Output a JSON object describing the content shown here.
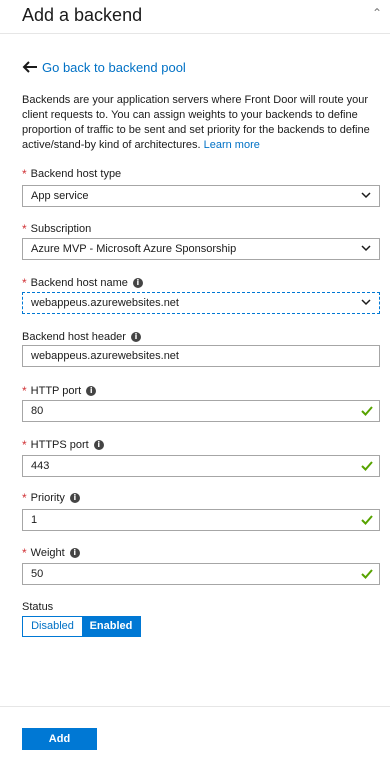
{
  "header": {
    "title": "Add a backend",
    "control_glyph": "⌃"
  },
  "back_link": {
    "label": "Go back to backend pool",
    "icon": "arrow-left-icon"
  },
  "description": {
    "text": "Backends are your application servers where Front Door will route your client requests to. You can assign weights to your backends to define proportion of traffic to be sent and set priority for the backends to define active/stand-by kind of architectures.",
    "link": "Learn more"
  },
  "fields": {
    "host_type": {
      "label": "Backend host type",
      "value": "App service"
    },
    "subscription": {
      "label": "Subscription",
      "value": "Azure MVP - Microsoft Azure Sponsorship"
    },
    "host_name": {
      "label": "Backend host name",
      "value": "webappeus.azurewebsites.net"
    },
    "host_header": {
      "label": "Backend host header",
      "value": "webappeus.azurewebsites.net"
    },
    "http_port": {
      "label": "HTTP port",
      "value": "80"
    },
    "https_port": {
      "label": "HTTPS port",
      "value": "443"
    },
    "priority": {
      "label": "Priority",
      "value": "1"
    },
    "weight": {
      "label": "Weight",
      "value": "50"
    }
  },
  "status": {
    "label": "Status",
    "disabled": "Disabled",
    "enabled": "Enabled",
    "selected": "Enabled"
  },
  "actions": {
    "add": "Add"
  },
  "colors": {
    "accent": "#0078d4",
    "link": "#0071c5",
    "required": "#d13438",
    "valid": "#57a300"
  }
}
